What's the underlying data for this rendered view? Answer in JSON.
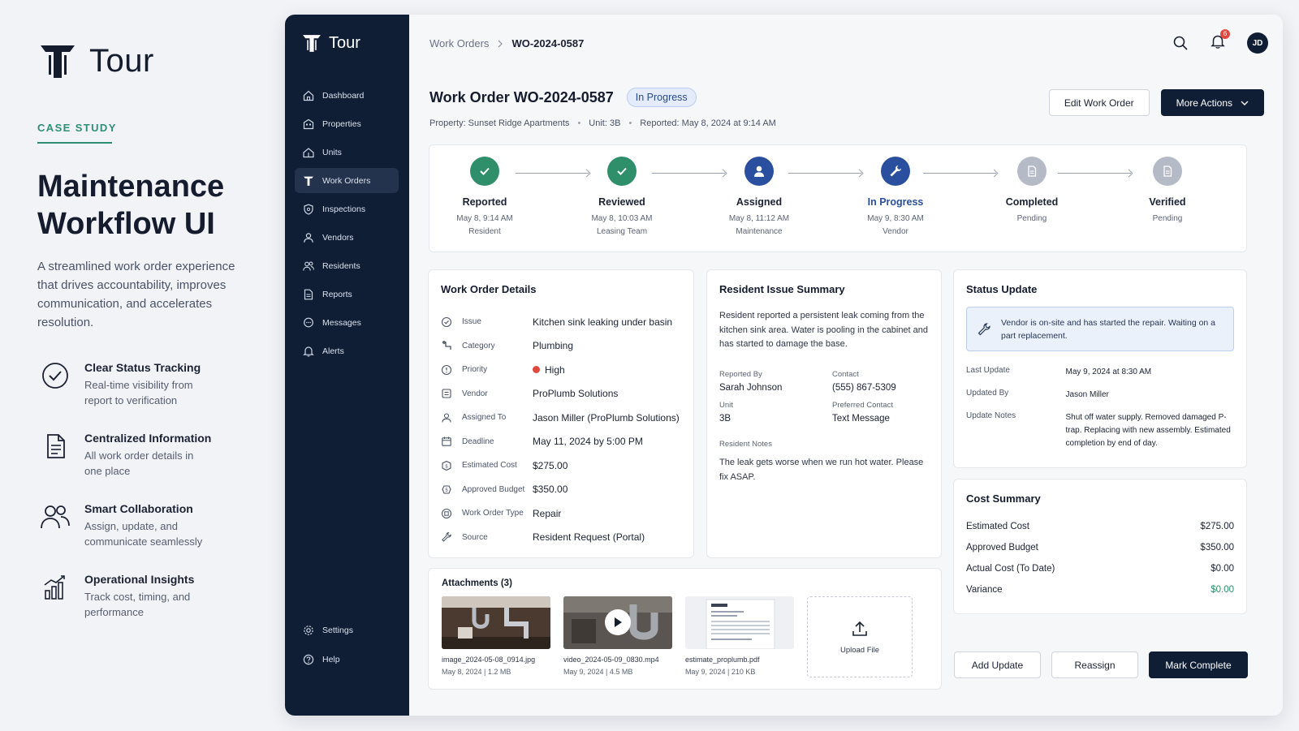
{
  "case_study": {
    "logo_text": "Tour",
    "kicker": "CASE STUDY",
    "title": "Maintenance Workflow UI",
    "description": "A streamlined work order experience that drives accountability, improves communication, and accelerates resolution.",
    "features": [
      {
        "icon": "check-circle-icon",
        "title": "Clear Status Tracking",
        "desc": "Real-time visibility from report to verification"
      },
      {
        "icon": "document-icon",
        "title": "Centralized Information",
        "desc": "All work order details in one place"
      },
      {
        "icon": "people-icon",
        "title": "Smart Collaboration",
        "desc": "Assign, update, and communicate seamlessly"
      },
      {
        "icon": "bar-chart-icon",
        "title": "Operational Insights",
        "desc": "Track cost, timing, and performance"
      }
    ]
  },
  "sidebar": {
    "logo_text": "Tour",
    "items": [
      {
        "label": "Dashboard",
        "icon": "home-icon"
      },
      {
        "label": "Properties",
        "icon": "building-icon"
      },
      {
        "label": "Units",
        "icon": "units-icon"
      },
      {
        "label": "Work Orders",
        "icon": "work-orders-icon",
        "active": true
      },
      {
        "label": "Inspections",
        "icon": "shield-icon"
      },
      {
        "label": "Vendors",
        "icon": "person-icon"
      },
      {
        "label": "Residents",
        "icon": "people-icon"
      },
      {
        "label": "Reports",
        "icon": "report-icon"
      },
      {
        "label": "Messages",
        "icon": "message-icon"
      },
      {
        "label": "Alerts",
        "icon": "bell-icon"
      }
    ],
    "bottom_items": [
      {
        "label": "Settings",
        "icon": "gear-icon"
      },
      {
        "label": "Help",
        "icon": "help-icon"
      }
    ]
  },
  "topbar": {
    "breadcrumb_parent": "Work Orders",
    "breadcrumb_current": "WO-2024-0587",
    "notification_count": "6",
    "avatar_initials": "JD"
  },
  "work_order": {
    "title": "Work Order WO-2024-0587",
    "status": "In Progress",
    "property": "Property: Sunset Ridge Apartments",
    "unit": "Unit: 3B",
    "reported": "Reported: May 8, 2024 at 9:14 AM",
    "edit_label": "Edit Work Order",
    "more_label": "More Actions"
  },
  "timeline": [
    {
      "label": "Reported",
      "date": "May 8, 9:14 AM",
      "who": "Resident",
      "state": "done"
    },
    {
      "label": "Reviewed",
      "date": "May 8, 10:03 AM",
      "who": "Leasing Team",
      "state": "done"
    },
    {
      "label": "Assigned",
      "date": "May 8, 11:12 AM",
      "who": "Maintenance",
      "state": "active"
    },
    {
      "label": "In Progress",
      "date": "May 9, 8:30 AM",
      "who": "Vendor",
      "state": "current"
    },
    {
      "label": "Completed",
      "date": "Pending",
      "who": "",
      "state": "pending"
    },
    {
      "label": "Verified",
      "date": "Pending",
      "who": "",
      "state": "pending"
    }
  ],
  "details": {
    "title": "Work Order Details",
    "rows": [
      {
        "key": "Issue",
        "value": "Kitchen sink leaking under basin",
        "icon": "alert-circle-icon"
      },
      {
        "key": "Category",
        "value": "Plumbing",
        "icon": "pipe-icon"
      },
      {
        "key": "Priority",
        "value": "High",
        "icon": "priority-icon"
      },
      {
        "key": "Vendor",
        "value": "ProPlumb Solutions",
        "icon": "vendor-icon"
      },
      {
        "key": "Assigned To",
        "value": "Jason Miller (ProPlumb Solutions)",
        "icon": "user-icon"
      },
      {
        "key": "Deadline",
        "value": "May 11, 2024 by 5:00 PM",
        "icon": "calendar-icon"
      },
      {
        "key": "Estimated Cost",
        "value": "$275.00",
        "icon": "dollar-icon"
      },
      {
        "key": "Approved Budget",
        "value": "$350.00",
        "icon": "budget-icon"
      },
      {
        "key": "Work Order Type",
        "value": "Repair",
        "icon": "type-icon"
      },
      {
        "key": "Source",
        "value": "Resident Request (Portal)",
        "icon": "wrench-icon"
      }
    ]
  },
  "resident": {
    "title": "Resident Issue Summary",
    "summary": "Resident reported a persistent leak coming from the kitchen sink area. Water is pooling in the cabinet and has started to damage the base.",
    "reported_by_label": "Reported By",
    "reported_by": "Sarah Johnson",
    "contact_label": "Contact",
    "contact": "(555) 867-5309",
    "unit_label": "Unit",
    "unit": "3B",
    "preferred_label": "Preferred Contact",
    "preferred": "Text Message",
    "notes_label": "Resident Notes",
    "notes": "The leak gets worse when we run hot water. Please fix ASAP."
  },
  "status_update": {
    "title": "Status Update",
    "message": "Vendor is on-site and has started the repair. Waiting on a part replacement.",
    "rows": [
      {
        "key": "Last Update",
        "value": "May 9, 2024 at 8:30 AM"
      },
      {
        "key": "Updated By",
        "value": "Jason Miller"
      },
      {
        "key": "Update Notes",
        "value": "Shut off water supply. Removed damaged P-trap. Replacing with new assembly. Estimated completion by end of day."
      }
    ]
  },
  "cost": {
    "title": "Cost Summary",
    "rows": [
      {
        "key": "Estimated Cost",
        "value": "$275.00"
      },
      {
        "key": "Approved Budget",
        "value": "$350.00"
      },
      {
        "key": "Actual Cost (To Date)",
        "value": "$0.00"
      },
      {
        "key": "Variance",
        "value": "$0.00",
        "color": "#2f8f6a"
      }
    ]
  },
  "attachments": {
    "title": "Attachments (3)",
    "items": [
      {
        "name": "image_2024-05-08_0914.jpg",
        "meta": "May 8, 2024 | 1.2 MB"
      },
      {
        "name": "video_2024-05-09_0830.mp4",
        "meta": "May 9, 2024 | 4.5 MB"
      },
      {
        "name": "estimate_proplumb.pdf",
        "meta": "May 9, 2024 | 210 KB"
      }
    ],
    "upload_label": "Upload File"
  },
  "actions": {
    "add_update": "Add Update",
    "reassign": "Reassign",
    "mark_complete": "Mark Complete"
  }
}
